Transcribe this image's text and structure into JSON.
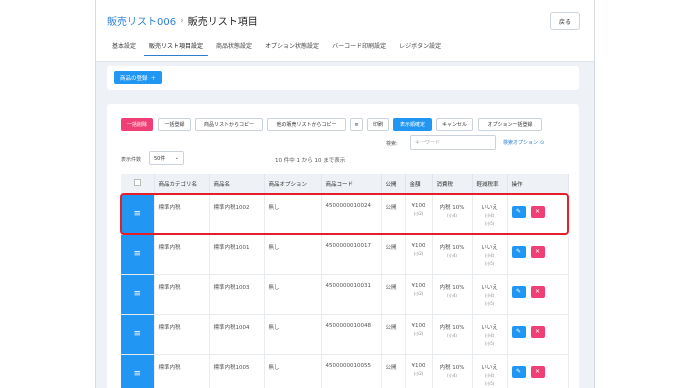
{
  "breadcrumb": {
    "parent": "販売リスト006",
    "current": "販売リスト項目"
  },
  "back_label": "戻る",
  "tabs": [
    {
      "label": "基本設定"
    },
    {
      "label": "販売リスト項目設定"
    },
    {
      "label": "商品状態設定"
    },
    {
      "label": "オプション状態設定"
    },
    {
      "label": "バーコード印刷設定"
    },
    {
      "label": "レジボタン設定"
    }
  ],
  "add_product_label": "商品の登録",
  "toolbar": {
    "bulk_delete": "一括削除",
    "bulk_register": "一括登録",
    "copy_from_list": "商品リストからコピー",
    "copy_from_other": "他の販売リストからコピー",
    "list_icon": "≡",
    "print": "印刷",
    "order_confirm": "表示順確定",
    "cancel": "キャンセル",
    "option_bulk": "オプション一括登録"
  },
  "search": {
    "label": "検索:",
    "placeholder": "キーワード",
    "options_label": "検索オプション"
  },
  "page_count": {
    "label": "表示件数",
    "value": "50件"
  },
  "range_text": "10 件中 1 から 10 まで表示",
  "columns": [
    "",
    "商品カテゴリ名",
    "商品名",
    "商品オプション",
    "商品コード",
    "公開",
    "金額",
    "消費税",
    "軽減税率",
    "操作"
  ],
  "rows": [
    {
      "category": "標準内税",
      "name": "標準内税1002",
      "option": "無し",
      "code": "4500000010024",
      "public": "公開",
      "price": "¥100",
      "price_sub": "(小2)",
      "tax": "内税 10%",
      "tax_sub": "(小4)",
      "reduced": "いいえ",
      "reduced_sub1": "(小4)",
      "reduced_sub2": "(小5)"
    },
    {
      "category": "標準内税",
      "name": "標準内税1001",
      "option": "無し",
      "code": "4500000010017",
      "public": "公開",
      "price": "¥100",
      "price_sub": "(小2)",
      "tax": "内税 10%",
      "tax_sub": "(小4)",
      "reduced": "いいえ",
      "reduced_sub1": "(小4)",
      "reduced_sub2": "(小5)"
    },
    {
      "category": "標準内税",
      "name": "標準内税1003",
      "option": "無し",
      "code": "4500000010031",
      "public": "公開",
      "price": "¥100",
      "price_sub": "(小2)",
      "tax": "内税 10%",
      "tax_sub": "(小4)",
      "reduced": "いいえ",
      "reduced_sub1": "(小4)",
      "reduced_sub2": "(小5)"
    },
    {
      "category": "標準内税",
      "name": "標準内税1004",
      "option": "無し",
      "code": "4500000010048",
      "public": "公開",
      "price": "¥100",
      "price_sub": "(小2)",
      "tax": "内税 10%",
      "tax_sub": "(小4)",
      "reduced": "いいえ",
      "reduced_sub1": "(小4)",
      "reduced_sub2": "(小5)"
    },
    {
      "category": "標準内税",
      "name": "標準内税1005",
      "option": "無し",
      "code": "4500000010055",
      "public": "公開",
      "price": "¥100",
      "price_sub": "(小2)",
      "tax": "内税 10%",
      "tax_sub": "(小4)",
      "reduced": "いいえ",
      "reduced_sub1": "(小4)",
      "reduced_sub2": "(小5)"
    }
  ],
  "colors": {
    "accent": "#2196f3",
    "danger": "#f03f77",
    "highlight": "#e3202a"
  }
}
